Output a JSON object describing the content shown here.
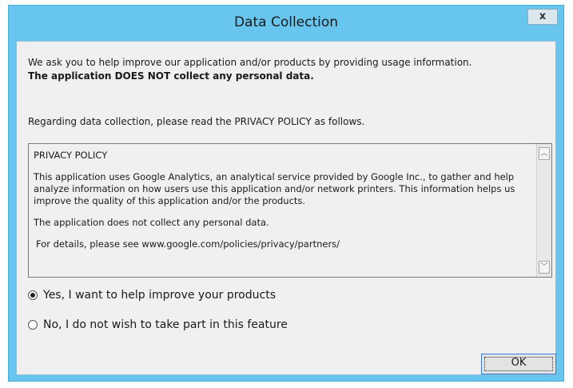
{
  "window": {
    "title": "Data Collection",
    "close_glyph": "x"
  },
  "intro": {
    "line1": "We ask you to help improve our application and/or products by providing usage information.",
    "line2": "The application DOES NOT collect any personal data."
  },
  "regarding": "Regarding data collection, please read the PRIVACY POLICY as follows.",
  "policy": {
    "heading": "PRIVACY POLICY",
    "paragraph1": "This application uses Google Analytics, an analytical service provided by Google Inc., to gather and help analyze information on how users use this application and/or network printers. This information helps us improve the quality of this application and/or the products.",
    "paragraph2": "The application does not collect any personal data.",
    "paragraph3": "For details, please see www.google.com/policies/privacy/partners/"
  },
  "options": [
    {
      "label": "Yes, I want to help improve your products",
      "selected": true
    },
    {
      "label": "No, I do not wish to take part in this feature",
      "selected": false
    }
  ],
  "buttons": {
    "ok": "OK"
  }
}
